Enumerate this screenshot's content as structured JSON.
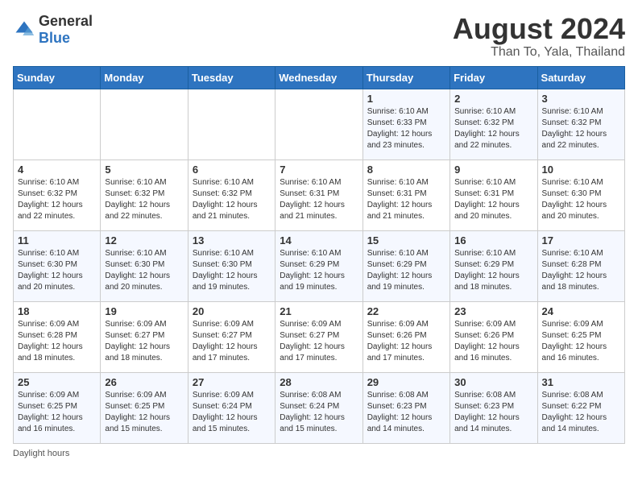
{
  "logo": {
    "general": "General",
    "blue": "Blue"
  },
  "title": {
    "month_year": "August 2024",
    "location": "Than To, Yala, Thailand"
  },
  "days_of_week": [
    "Sunday",
    "Monday",
    "Tuesday",
    "Wednesday",
    "Thursday",
    "Friday",
    "Saturday"
  ],
  "weeks": [
    [
      {
        "day": "",
        "info": ""
      },
      {
        "day": "",
        "info": ""
      },
      {
        "day": "",
        "info": ""
      },
      {
        "day": "",
        "info": ""
      },
      {
        "day": "1",
        "info": "Sunrise: 6:10 AM\nSunset: 6:33 PM\nDaylight: 12 hours\nand 23 minutes."
      },
      {
        "day": "2",
        "info": "Sunrise: 6:10 AM\nSunset: 6:32 PM\nDaylight: 12 hours\nand 22 minutes."
      },
      {
        "day": "3",
        "info": "Sunrise: 6:10 AM\nSunset: 6:32 PM\nDaylight: 12 hours\nand 22 minutes."
      }
    ],
    [
      {
        "day": "4",
        "info": "Sunrise: 6:10 AM\nSunset: 6:32 PM\nDaylight: 12 hours\nand 22 minutes."
      },
      {
        "day": "5",
        "info": "Sunrise: 6:10 AM\nSunset: 6:32 PM\nDaylight: 12 hours\nand 22 minutes."
      },
      {
        "day": "6",
        "info": "Sunrise: 6:10 AM\nSunset: 6:32 PM\nDaylight: 12 hours\nand 21 minutes."
      },
      {
        "day": "7",
        "info": "Sunrise: 6:10 AM\nSunset: 6:31 PM\nDaylight: 12 hours\nand 21 minutes."
      },
      {
        "day": "8",
        "info": "Sunrise: 6:10 AM\nSunset: 6:31 PM\nDaylight: 12 hours\nand 21 minutes."
      },
      {
        "day": "9",
        "info": "Sunrise: 6:10 AM\nSunset: 6:31 PM\nDaylight: 12 hours\nand 20 minutes."
      },
      {
        "day": "10",
        "info": "Sunrise: 6:10 AM\nSunset: 6:30 PM\nDaylight: 12 hours\nand 20 minutes."
      }
    ],
    [
      {
        "day": "11",
        "info": "Sunrise: 6:10 AM\nSunset: 6:30 PM\nDaylight: 12 hours\nand 20 minutes."
      },
      {
        "day": "12",
        "info": "Sunrise: 6:10 AM\nSunset: 6:30 PM\nDaylight: 12 hours\nand 20 minutes."
      },
      {
        "day": "13",
        "info": "Sunrise: 6:10 AM\nSunset: 6:30 PM\nDaylight: 12 hours\nand 19 minutes."
      },
      {
        "day": "14",
        "info": "Sunrise: 6:10 AM\nSunset: 6:29 PM\nDaylight: 12 hours\nand 19 minutes."
      },
      {
        "day": "15",
        "info": "Sunrise: 6:10 AM\nSunset: 6:29 PM\nDaylight: 12 hours\nand 19 minutes."
      },
      {
        "day": "16",
        "info": "Sunrise: 6:10 AM\nSunset: 6:29 PM\nDaylight: 12 hours\nand 18 minutes."
      },
      {
        "day": "17",
        "info": "Sunrise: 6:10 AM\nSunset: 6:28 PM\nDaylight: 12 hours\nand 18 minutes."
      }
    ],
    [
      {
        "day": "18",
        "info": "Sunrise: 6:09 AM\nSunset: 6:28 PM\nDaylight: 12 hours\nand 18 minutes."
      },
      {
        "day": "19",
        "info": "Sunrise: 6:09 AM\nSunset: 6:27 PM\nDaylight: 12 hours\nand 18 minutes."
      },
      {
        "day": "20",
        "info": "Sunrise: 6:09 AM\nSunset: 6:27 PM\nDaylight: 12 hours\nand 17 minutes."
      },
      {
        "day": "21",
        "info": "Sunrise: 6:09 AM\nSunset: 6:27 PM\nDaylight: 12 hours\nand 17 minutes."
      },
      {
        "day": "22",
        "info": "Sunrise: 6:09 AM\nSunset: 6:26 PM\nDaylight: 12 hours\nand 17 minutes."
      },
      {
        "day": "23",
        "info": "Sunrise: 6:09 AM\nSunset: 6:26 PM\nDaylight: 12 hours\nand 16 minutes."
      },
      {
        "day": "24",
        "info": "Sunrise: 6:09 AM\nSunset: 6:25 PM\nDaylight: 12 hours\nand 16 minutes."
      }
    ],
    [
      {
        "day": "25",
        "info": "Sunrise: 6:09 AM\nSunset: 6:25 PM\nDaylight: 12 hours\nand 16 minutes."
      },
      {
        "day": "26",
        "info": "Sunrise: 6:09 AM\nSunset: 6:25 PM\nDaylight: 12 hours\nand 15 minutes."
      },
      {
        "day": "27",
        "info": "Sunrise: 6:09 AM\nSunset: 6:24 PM\nDaylight: 12 hours\nand 15 minutes."
      },
      {
        "day": "28",
        "info": "Sunrise: 6:08 AM\nSunset: 6:24 PM\nDaylight: 12 hours\nand 15 minutes."
      },
      {
        "day": "29",
        "info": "Sunrise: 6:08 AM\nSunset: 6:23 PM\nDaylight: 12 hours\nand 14 minutes."
      },
      {
        "day": "30",
        "info": "Sunrise: 6:08 AM\nSunset: 6:23 PM\nDaylight: 12 hours\nand 14 minutes."
      },
      {
        "day": "31",
        "info": "Sunrise: 6:08 AM\nSunset: 6:22 PM\nDaylight: 12 hours\nand 14 minutes."
      }
    ]
  ],
  "footer": {
    "daylight_note": "Daylight hours"
  }
}
